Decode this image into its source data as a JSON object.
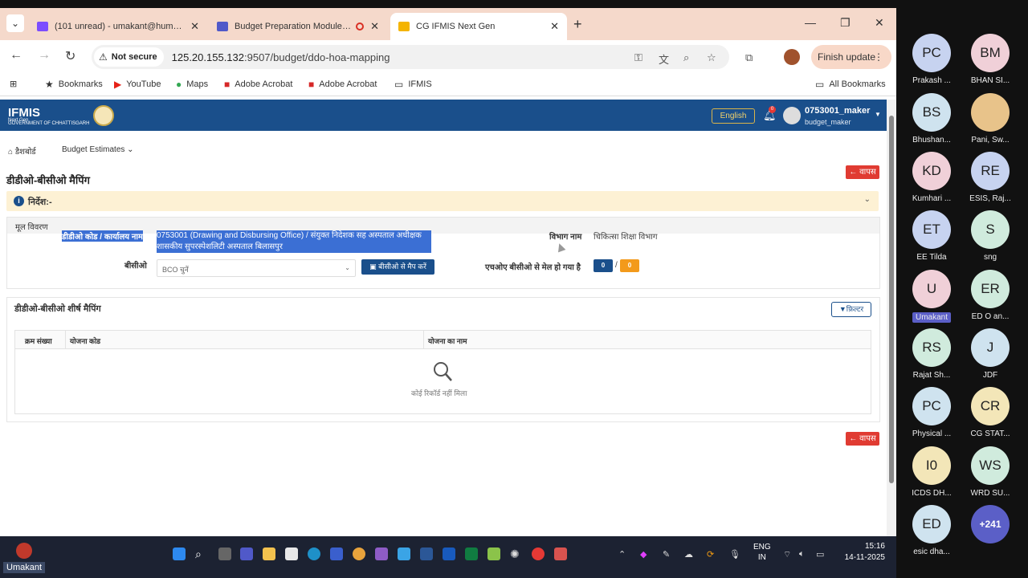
{
  "browser": {
    "tabs": [
      {
        "title": "(101 unread) - umakant@humanit...",
        "color": "#7c4dff"
      },
      {
        "title": "Budget Preparation Module Te...",
        "color": "#5059c9"
      },
      {
        "title": "CG IFMIS Next Gen",
        "color": "#f4b400"
      }
    ],
    "security_label": "Not secure",
    "url_host": "125.20.155.132",
    "url_path": ":9507/budget/ddo-hoa-mapping",
    "finish_update": "Finish update",
    "bookmarks": [
      "Bookmarks",
      "YouTube",
      "Maps",
      "Adobe Acrobat",
      "Adobe Acrobat",
      "IFMIS"
    ],
    "all_bookmarks": "All Bookmarks"
  },
  "app": {
    "logo_title": "IFMIS",
    "logo_sub": "Next Gen",
    "logo_gov": "GOVERNMENT OF CHHATTISGARH",
    "language": "English",
    "notif_count": "0",
    "user_name": "0753001_maker",
    "user_role": "budget_maker",
    "menu_dashboard": "डैशबोर्ड",
    "menu_budget": "Budget Estimates",
    "page_title": "डीडीओ-बीसीओ मैपिंग",
    "back_label": "वापस",
    "notice_title": "निर्देश:-",
    "basic_details": "मूल विवरण",
    "ddo_label": "डीडीओ कोड / कार्यालय नाम",
    "ddo_value": "0753001 (Drawing and Disbursing Office) / संयुक्त निदेशक सह अस्पताल अधीक्षक शासकीय सुपरस्पेशलिटी अस्पताल बिलासपुर",
    "dept_label": "विभाग नाम",
    "dept_value": "चिकित्सा शिक्षा विभाग",
    "bco_label": "बीसीओ",
    "bco_placeholder": "BCO चुनें",
    "map_button": "बीसीओ से मैप करें",
    "hoa_matched_label": "एचओए बीसीओ से मेल हो गया है",
    "count_a": "0",
    "count_sep": "/",
    "count_b": "0",
    "section_title": "डीडीओ-बीसीओ शीर्ष मैपिंग",
    "filter_label": "फ़िल्टर",
    "table_headers": [
      "क्रम संख्या",
      "योजना कोड",
      "योजना का नाम"
    ],
    "empty_text": "कोई रिकॉर्ड नहीं मिला"
  },
  "participants": [
    {
      "initials": "PC",
      "name": "Prakash ...",
      "color": "#c7d3f0"
    },
    {
      "initials": "BM",
      "name": "BHAN SI...",
      "color": "#f0d0d8"
    },
    {
      "initials": "BS",
      "name": "Bhushan...",
      "color": "#cfe3ef"
    },
    {
      "initials": "",
      "name": "Pani, Sw...",
      "color": "#e8c38a"
    },
    {
      "initials": "KD",
      "name": "Kumhari ...",
      "color": "#f0d0d8"
    },
    {
      "initials": "RE",
      "name": "ESIS, Raj...",
      "color": "#c7d3f0"
    },
    {
      "initials": "ET",
      "name": "EE Tilda",
      "color": "#c7d3f0"
    },
    {
      "initials": "S",
      "name": "sng",
      "color": "#d0ebdd"
    },
    {
      "initials": "U",
      "name": "Umakant",
      "color": "#f0d0d8"
    },
    {
      "initials": "ER",
      "name": "ED O an...",
      "color": "#d0ebdd"
    },
    {
      "initials": "RS",
      "name": "Rajat Sh...",
      "color": "#d0ebdd"
    },
    {
      "initials": "J",
      "name": "JDF",
      "color": "#cfe3ef"
    },
    {
      "initials": "PC",
      "name": "Physical ...",
      "color": "#cfe3ef"
    },
    {
      "initials": "CR",
      "name": "CG STAT...",
      "color": "#f3e6b8"
    },
    {
      "initials": "I0",
      "name": "ICDS DH...",
      "color": "#f3e6b8"
    },
    {
      "initials": "WS",
      "name": "WRD SU...",
      "color": "#d0ebdd"
    },
    {
      "initials": "ED",
      "name": "esic dha...",
      "color": "#cfe3ef"
    },
    {
      "initials": "+241",
      "name": "",
      "color": "#5b5fc7"
    }
  ],
  "taskbar": {
    "lang_1": "ENG",
    "lang_2": "IN",
    "time": "15:16",
    "date": "14-11-2025",
    "user_label": "Umakant"
  }
}
